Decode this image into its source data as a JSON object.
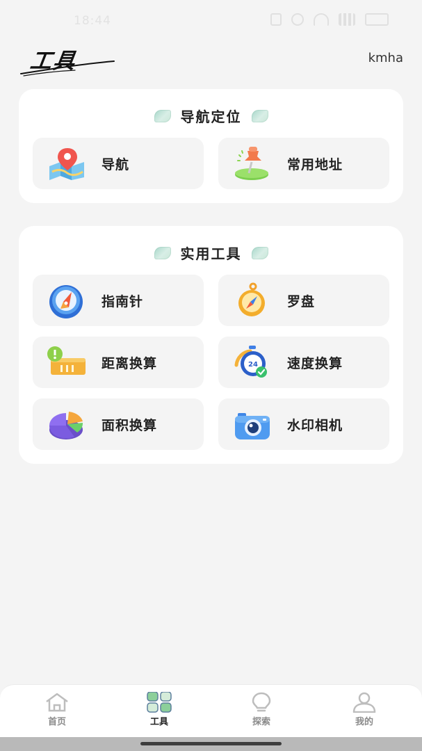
{
  "status_bar": {
    "time": "18:44",
    "battery": "100"
  },
  "header": {
    "title": "工具",
    "username": "kmha"
  },
  "nav_section": {
    "title": "导航定位",
    "items": [
      {
        "label": "导航",
        "icon": "map-pin-icon"
      },
      {
        "label": "常用地址",
        "icon": "pushpin-icon"
      }
    ]
  },
  "tools_section": {
    "title": "实用工具",
    "items": [
      {
        "label": "指南针",
        "icon": "compass-icon"
      },
      {
        "label": "罗盘",
        "icon": "orienteering-compass-icon"
      },
      {
        "label": "距离换算",
        "icon": "ruler-icon"
      },
      {
        "label": "速度换算",
        "icon": "stopwatch-icon"
      },
      {
        "label": "面积换算",
        "icon": "pie-chart-icon"
      },
      {
        "label": "水印相机",
        "icon": "camera-icon"
      }
    ]
  },
  "bottom_nav": {
    "items": [
      {
        "label": "首页",
        "icon": "home-icon",
        "active": false
      },
      {
        "label": "工具",
        "icon": "grid-icon",
        "active": true
      },
      {
        "label": "探索",
        "icon": "lightbulb-icon",
        "active": false
      },
      {
        "label": "我的",
        "icon": "user-icon",
        "active": false
      }
    ]
  },
  "colors": {
    "background": "#f4f4f4",
    "card": "#ffffff",
    "tile": "#f4f4f4",
    "accent_green": "#8cc8b8",
    "active_nav": "#222222",
    "inactive_nav": "#8b8b8b"
  }
}
